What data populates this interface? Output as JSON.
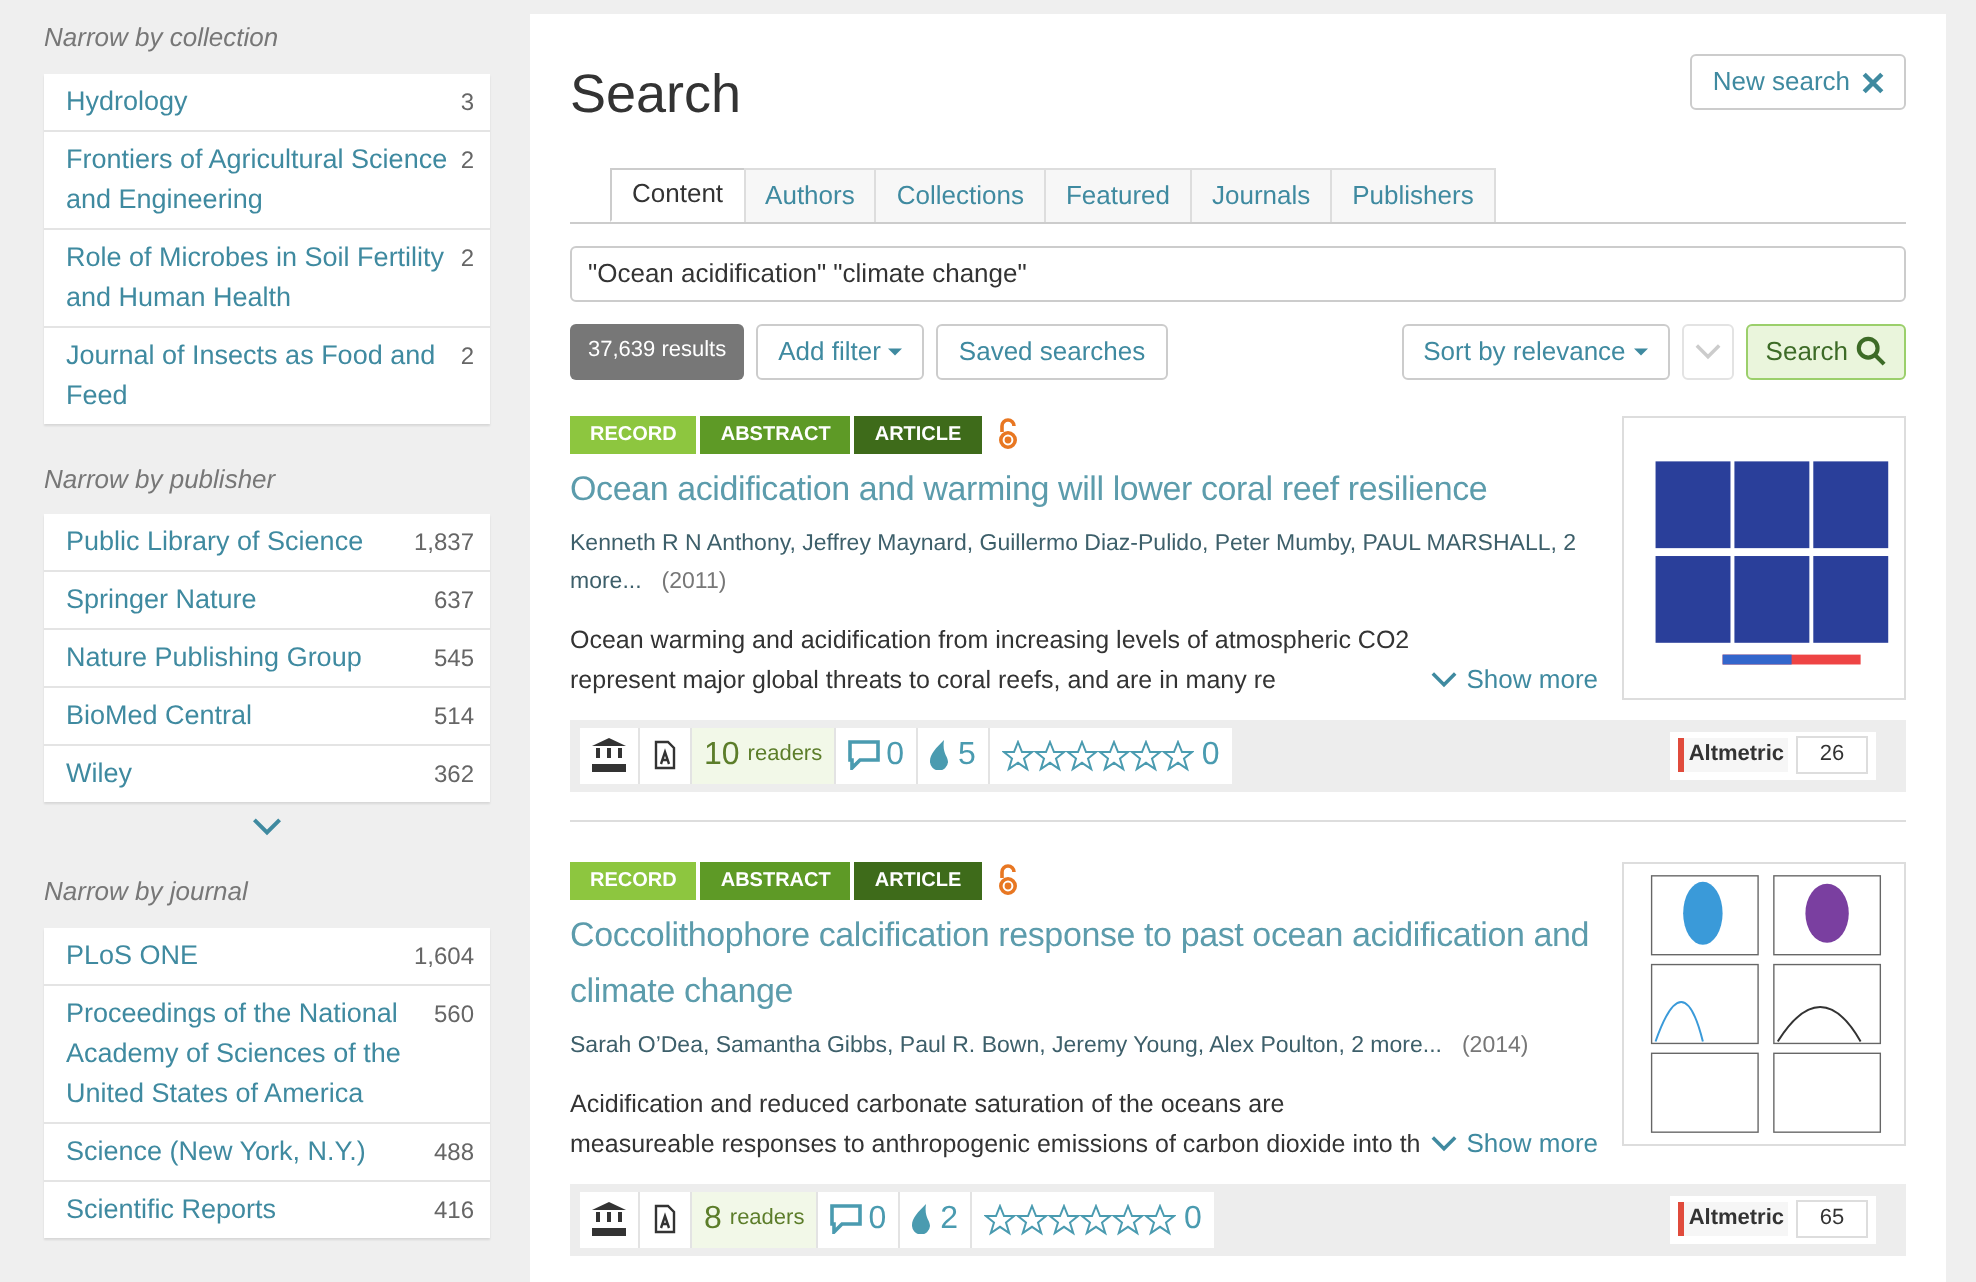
{
  "sidebar": {
    "sections": [
      {
        "heading": "Narrow by collection",
        "items": [
          {
            "label": "Hydrology",
            "count": "3"
          },
          {
            "label": "Frontiers of Agricultural Science and Engineering",
            "count": "2"
          },
          {
            "label": "Role of Microbes in Soil Fertility and Human Health",
            "count": "2"
          },
          {
            "label": "Journal of Insects as Food and Feed",
            "count": "2"
          }
        ],
        "more": false
      },
      {
        "heading": "Narrow by publisher",
        "items": [
          {
            "label": "Public Library of Science",
            "count": "1,837"
          },
          {
            "label": "Springer Nature",
            "count": "637"
          },
          {
            "label": "Nature Publishing Group",
            "count": "545"
          },
          {
            "label": "BioMed Central",
            "count": "514"
          },
          {
            "label": "Wiley",
            "count": "362"
          }
        ],
        "more": true
      },
      {
        "heading": "Narrow by journal",
        "items": [
          {
            "label": "PLoS ONE",
            "count": "1,604"
          },
          {
            "label": "Proceedings of the National Academy of Sciences of the United States of America",
            "count": "560"
          },
          {
            "label": "Science (New York, N.Y.)",
            "count": "488"
          },
          {
            "label": "Scientific Reports",
            "count": "416"
          }
        ],
        "more": false
      }
    ]
  },
  "main": {
    "title": "Search",
    "new_search": "New search",
    "tabs": [
      {
        "label": "Content",
        "selected": true
      },
      {
        "label": "Authors",
        "selected": false
      },
      {
        "label": "Collections",
        "selected": false
      },
      {
        "label": "Featured",
        "selected": false
      },
      {
        "label": "Journals",
        "selected": false
      },
      {
        "label": "Publishers",
        "selected": false
      }
    ],
    "query": "\"Ocean acidification\" \"climate change\"",
    "results_count": "37,639 results",
    "add_filter": "Add filter",
    "saved_searches": "Saved searches",
    "sort": "Sort by relevance",
    "search_button": "Search",
    "results": [
      {
        "tags": [
          {
            "label": "RECORD",
            "kind": "record"
          },
          {
            "label": "ABSTRACT",
            "kind": "abstract"
          },
          {
            "label": "ARTICLE",
            "kind": "article"
          }
        ],
        "open_access": true,
        "title": "Ocean acidification and warming will lower coral reef resilience",
        "authors": "Kenneth R N Anthony, Jeffrey Maynard, Guillermo Diaz-Pulido, Peter Mumby, PAUL MARSHALL, 2 more...",
        "year": "(2011)",
        "abstract": "Ocean warming and acidification from increasing levels of atmospheric CO2 represent major global threats to coral reefs, and are in many re",
        "show_more": "Show more",
        "readers": "10",
        "readers_label": "readers",
        "comments": "0",
        "mentions": "5",
        "stars": 0,
        "ratings": "0",
        "altmetric_label": "Altmetric",
        "altmetric": "26"
      },
      {
        "tags": [
          {
            "label": "RECORD",
            "kind": "record"
          },
          {
            "label": "ABSTRACT",
            "kind": "abstract"
          },
          {
            "label": "ARTICLE",
            "kind": "article"
          }
        ],
        "open_access": true,
        "title": "Coccolithophore calcification response to past ocean acidification and climate change",
        "authors": "Sarah O’Dea, Samantha Gibbs, Paul R. Bown, Jeremy Young, Alex Poulton, 2 more...",
        "year": "(2014)",
        "abstract": "Acidification and reduced carbonate saturation of the oceans are measureable responses to anthropogenic emissions of carbon dioxide into th",
        "show_more": "Show more",
        "readers": "8",
        "readers_label": "readers",
        "comments": "0",
        "mentions": "2",
        "stars": 0,
        "ratings": "0",
        "altmetric_label": "Altmetric",
        "altmetric": "65"
      }
    ]
  }
}
